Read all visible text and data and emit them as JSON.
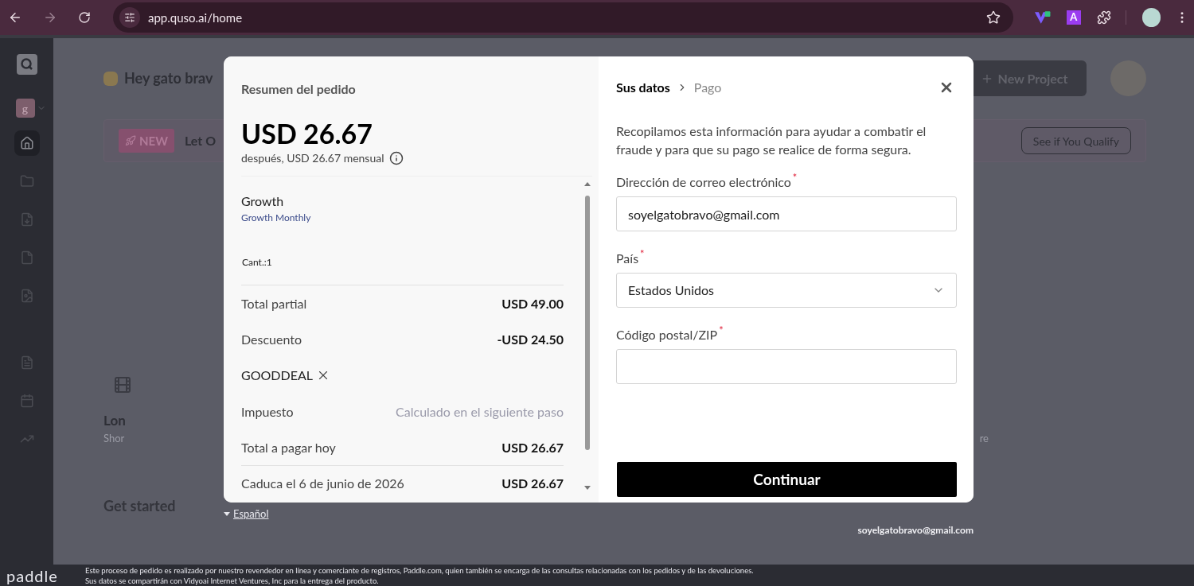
{
  "browser": {
    "url": "app.quso.ai/home",
    "extension_letter": "A"
  },
  "sidebar": {
    "workspace_letter": "g",
    "items": [
      {
        "kind": "home",
        "selected": true
      },
      {
        "kind": "folder",
        "selected": false
      },
      {
        "kind": "file-down",
        "selected": false
      },
      {
        "kind": "file",
        "selected": false
      },
      {
        "kind": "file-image",
        "selected": false
      },
      {
        "kind": "file-text",
        "selected": false
      },
      {
        "kind": "calendar",
        "selected": false
      },
      {
        "kind": "trend",
        "selected": false
      }
    ]
  },
  "background": {
    "greeting": "Hey gato brav",
    "new_project": "New Project",
    "badge": "NEW",
    "banner_text": "Let O",
    "qualify": "See if You Qualify",
    "card_title": "Lon",
    "card_subtitle": "Shor",
    "card_right": "re",
    "get_started": "Get started",
    "email": "soyelgatobravo@gmail.com"
  },
  "summary": {
    "title": "Resumen del pedido",
    "price": "USD 26.67",
    "subtitle": "después, USD 26.67 mensual",
    "product": "Growth",
    "plan": "Growth Monthly",
    "quantity": "Cant.:1",
    "rows": [
      {
        "kind": "line",
        "label": "Total partial",
        "value": "USD 49.00"
      },
      {
        "kind": "line",
        "label": "Descuento",
        "value": "-USD 24.50"
      },
      {
        "kind": "coupon",
        "label": "GOODDEAL"
      },
      {
        "kind": "muted",
        "label": "Impuesto",
        "value": "Calculado en el siguiente paso"
      },
      {
        "kind": "line",
        "label": "Total a pagar hoy",
        "value": "USD 26.67"
      },
      {
        "kind": "divided",
        "label": "Caduca el 6 de junio de 2026",
        "value": "USD 26.67"
      }
    ]
  },
  "language": "Español",
  "checkout": {
    "steps": [
      {
        "label": "Sus datos",
        "selected": true
      },
      {
        "label": "Pago",
        "selected": false
      }
    ],
    "intro": "Recopilamos esta información para ayudar a combatir el fraude y para que su pago se realice de forma segura.",
    "fields": [
      {
        "kind": "text",
        "label": "Dirección de correo electrónico",
        "required_mark": "*",
        "value": "soyelgatobravo@gmail.com"
      },
      {
        "kind": "select",
        "label": "País",
        "required_mark": "*",
        "value": "Estados Unidos"
      },
      {
        "kind": "text",
        "label": "Código postal/ZIP",
        "required_mark": "*"
      }
    ],
    "submit": "Continuar"
  },
  "footer": {
    "logo": "paddle",
    "lines": [
      "Este proceso de pedido es realizado por nuestro revendedor en línea y comerciante de registros, Paddle.com, quien también se encarga de las consultas relacionadas con los pedidos y de las devoluciones.",
      "Sus datos se compartirán con Vidyoai Internet Ventures, Inc para la entrega del producto."
    ]
  }
}
